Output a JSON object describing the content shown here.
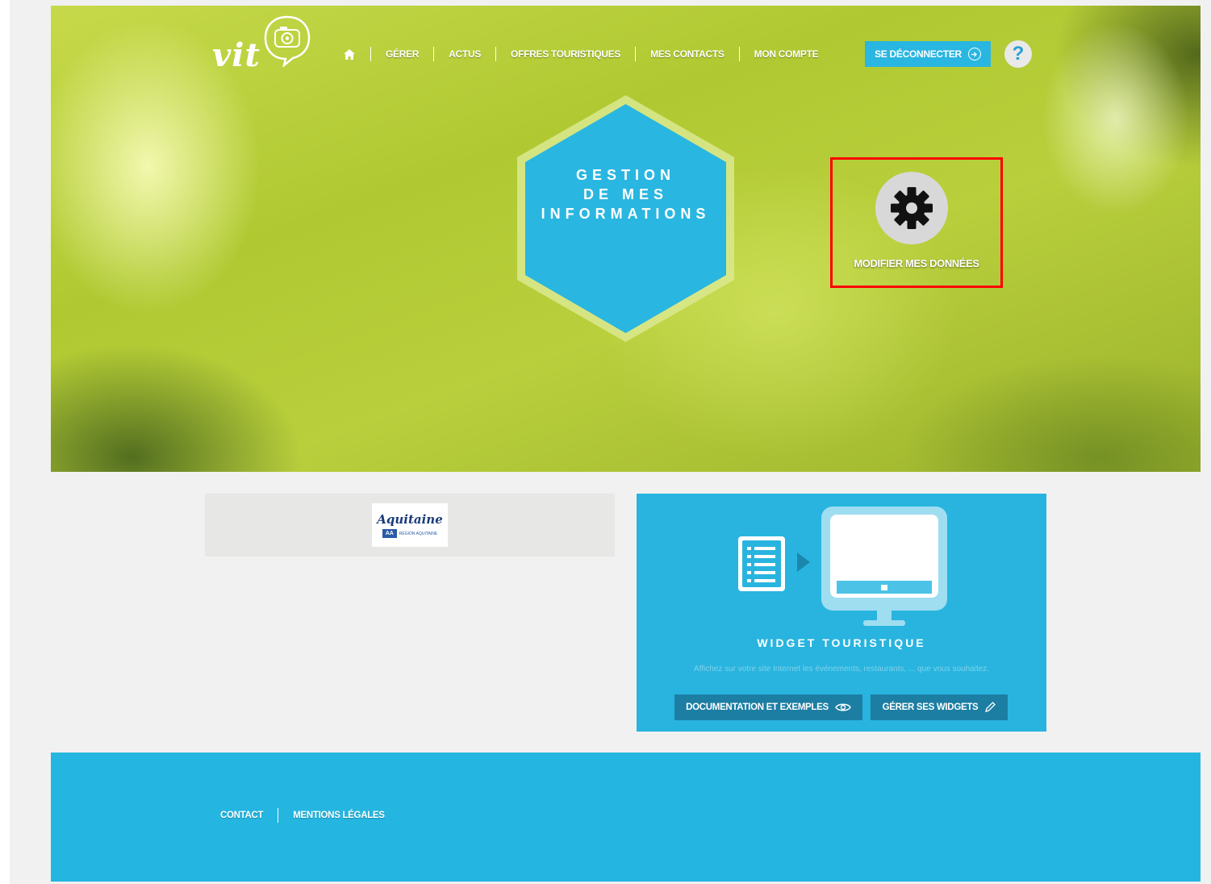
{
  "brand": {
    "logo_text": "vit"
  },
  "nav": {
    "home_icon": "home-icon",
    "items": [
      "GÉRER",
      "ACTUS",
      "OFFRES TOURISTIQUES",
      "MES CONTACTS",
      "MON COMPTE"
    ]
  },
  "header": {
    "logout_label": "SE DÉCONNECTER",
    "help_label": "?"
  },
  "hero": {
    "hex_title_lines": [
      "GESTION",
      "DE MES",
      "INFORMATIONS"
    ],
    "action_label": "MODIFIER MES DONNÉES",
    "action_icon": "gear-icon"
  },
  "partner": {
    "name": "Aquitaine",
    "badge": "AA",
    "region": "RÉGION AQUITAINE"
  },
  "widget": {
    "title": "WIDGET TOURISTIQUE",
    "description": "Affichez sur votre site Internet les événements, restaurants, ... que vous souhaitez.",
    "doc_button": "DOCUMENTATION ET EXEMPLES",
    "manage_button": "GÉRER SES WIDGETS"
  },
  "footer": {
    "links": [
      "CONTACT",
      "MENTIONS LÉGALES"
    ]
  },
  "colors": {
    "accent_blue": "#28b4df",
    "button_dark_blue": "#1c7ea3",
    "highlight_red": "#ff0000"
  }
}
